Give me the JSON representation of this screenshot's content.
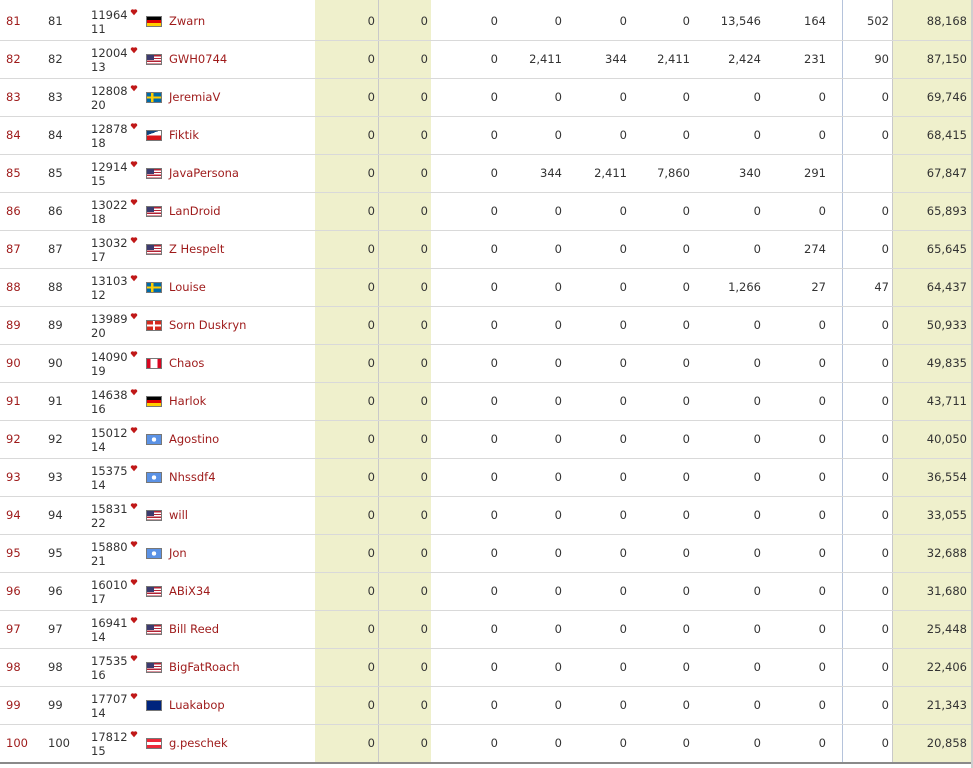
{
  "colors": {
    "accent_red": "#9e1a1a",
    "highlight_column": "#eff0cc"
  },
  "rows": [
    {
      "pos": "81",
      "rank": "81",
      "score": "11964",
      "sub": "11",
      "flag": "de",
      "name": "Zwarn",
      "c1": "0",
      "c2": "0",
      "c3": "0",
      "c4": "0",
      "c5": "0",
      "c6": "0",
      "c7": "13,546",
      "c8": "164",
      "c9": "502",
      "total": "88,168"
    },
    {
      "pos": "82",
      "rank": "82",
      "score": "12004",
      "sub": "13",
      "flag": "us",
      "name": "GWH0744",
      "c1": "0",
      "c2": "0",
      "c3": "0",
      "c4": "2,411",
      "c5": "344",
      "c6": "2,411",
      "c7": "2,424",
      "c8": "231",
      "c9": "90",
      "total": "87,150"
    },
    {
      "pos": "83",
      "rank": "83",
      "score": "12808",
      "sub": "20",
      "flag": "se",
      "name": "JeremiaV",
      "c1": "0",
      "c2": "0",
      "c3": "0",
      "c4": "0",
      "c5": "0",
      "c6": "0",
      "c7": "0",
      "c8": "0",
      "c9": "0",
      "total": "69,746"
    },
    {
      "pos": "84",
      "rank": "84",
      "score": "12878",
      "sub": "18",
      "flag": "cz",
      "name": "Fiktik",
      "c1": "0",
      "c2": "0",
      "c3": "0",
      "c4": "0",
      "c5": "0",
      "c6": "0",
      "c7": "0",
      "c8": "0",
      "c9": "0",
      "total": "68,415"
    },
    {
      "pos": "85",
      "rank": "85",
      "score": "12914",
      "sub": "15",
      "flag": "us",
      "name": "JavaPersona",
      "c1": "0",
      "c2": "0",
      "c3": "0",
      "c4": "344",
      "c5": "2,411",
      "c6": "7,860",
      "c7": "340",
      "c8": "291",
      "c9": "",
      "total": "67,847"
    },
    {
      "pos": "86",
      "rank": "86",
      "score": "13022",
      "sub": "18",
      "flag": "us",
      "name": "LanDroid",
      "c1": "0",
      "c2": "0",
      "c3": "0",
      "c4": "0",
      "c5": "0",
      "c6": "0",
      "c7": "0",
      "c8": "0",
      "c9": "0",
      "total": "65,893"
    },
    {
      "pos": "87",
      "rank": "87",
      "score": "13032",
      "sub": "17",
      "flag": "us",
      "name": "Z Hespelt",
      "c1": "0",
      "c2": "0",
      "c3": "0",
      "c4": "0",
      "c5": "0",
      "c6": "0",
      "c7": "0",
      "c8": "274",
      "c9": "0",
      "total": "65,645"
    },
    {
      "pos": "88",
      "rank": "88",
      "score": "13103",
      "sub": "12",
      "flag": "se",
      "name": "Louise",
      "c1": "0",
      "c2": "0",
      "c3": "0",
      "c4": "0",
      "c5": "0",
      "c6": "0",
      "c7": "1,266",
      "c8": "27",
      "c9": "47",
      "total": "64,437"
    },
    {
      "pos": "89",
      "rank": "89",
      "score": "13989",
      "sub": "20",
      "flag": "ch",
      "name": "Sorn Duskryn",
      "c1": "0",
      "c2": "0",
      "c3": "0",
      "c4": "0",
      "c5": "0",
      "c6": "0",
      "c7": "0",
      "c8": "0",
      "c9": "0",
      "total": "50,933"
    },
    {
      "pos": "90",
      "rank": "90",
      "score": "14090",
      "sub": "19",
      "flag": "ca",
      "name": "Chaos",
      "c1": "0",
      "c2": "0",
      "c3": "0",
      "c4": "0",
      "c5": "0",
      "c6": "0",
      "c7": "0",
      "c8": "0",
      "c9": "0",
      "total": "49,835"
    },
    {
      "pos": "91",
      "rank": "91",
      "score": "14638",
      "sub": "16",
      "flag": "de",
      "name": "Harlok",
      "c1": "0",
      "c2": "0",
      "c3": "0",
      "c4": "0",
      "c5": "0",
      "c6": "0",
      "c7": "0",
      "c8": "0",
      "c9": "0",
      "total": "43,711"
    },
    {
      "pos": "92",
      "rank": "92",
      "score": "15012",
      "sub": "14",
      "flag": "un",
      "name": "Agostino",
      "c1": "0",
      "c2": "0",
      "c3": "0",
      "c4": "0",
      "c5": "0",
      "c6": "0",
      "c7": "0",
      "c8": "0",
      "c9": "0",
      "total": "40,050"
    },
    {
      "pos": "93",
      "rank": "93",
      "score": "15375",
      "sub": "14",
      "flag": "un",
      "name": "Nhssdf4",
      "c1": "0",
      "c2": "0",
      "c3": "0",
      "c4": "0",
      "c5": "0",
      "c6": "0",
      "c7": "0",
      "c8": "0",
      "c9": "0",
      "total": "36,554"
    },
    {
      "pos": "94",
      "rank": "94",
      "score": "15831",
      "sub": "22",
      "flag": "us",
      "name": "will",
      "c1": "0",
      "c2": "0",
      "c3": "0",
      "c4": "0",
      "c5": "0",
      "c6": "0",
      "c7": "0",
      "c8": "0",
      "c9": "0",
      "total": "33,055"
    },
    {
      "pos": "95",
      "rank": "95",
      "score": "15880",
      "sub": "21",
      "flag": "un",
      "name": "Jon",
      "c1": "0",
      "c2": "0",
      "c3": "0",
      "c4": "0",
      "c5": "0",
      "c6": "0",
      "c7": "0",
      "c8": "0",
      "c9": "0",
      "total": "32,688"
    },
    {
      "pos": "96",
      "rank": "96",
      "score": "16010",
      "sub": "17",
      "flag": "us",
      "name": "ABiX34",
      "c1": "0",
      "c2": "0",
      "c3": "0",
      "c4": "0",
      "c5": "0",
      "c6": "0",
      "c7": "0",
      "c8": "0",
      "c9": "0",
      "total": "31,680"
    },
    {
      "pos": "97",
      "rank": "97",
      "score": "16941",
      "sub": "14",
      "flag": "us",
      "name": "Bill Reed",
      "c1": "0",
      "c2": "0",
      "c3": "0",
      "c4": "0",
      "c5": "0",
      "c6": "0",
      "c7": "0",
      "c8": "0",
      "c9": "0",
      "total": "25,448"
    },
    {
      "pos": "98",
      "rank": "98",
      "score": "17535",
      "sub": "16",
      "flag": "us",
      "name": "BigFatRoach",
      "c1": "0",
      "c2": "0",
      "c3": "0",
      "c4": "0",
      "c5": "0",
      "c6": "0",
      "c7": "0",
      "c8": "0",
      "c9": "0",
      "total": "22,406"
    },
    {
      "pos": "99",
      "rank": "99",
      "score": "17707",
      "sub": "14",
      "flag": "au",
      "name": "Luakabop",
      "c1": "0",
      "c2": "0",
      "c3": "0",
      "c4": "0",
      "c5": "0",
      "c6": "0",
      "c7": "0",
      "c8": "0",
      "c9": "0",
      "total": "21,343"
    },
    {
      "pos": "100",
      "rank": "100",
      "score": "17812",
      "sub": "15",
      "flag": "at",
      "name": "g.peschek",
      "c1": "0",
      "c2": "0",
      "c3": "0",
      "c4": "0",
      "c5": "0",
      "c6": "0",
      "c7": "0",
      "c8": "0",
      "c9": "0",
      "total": "20,858"
    }
  ]
}
